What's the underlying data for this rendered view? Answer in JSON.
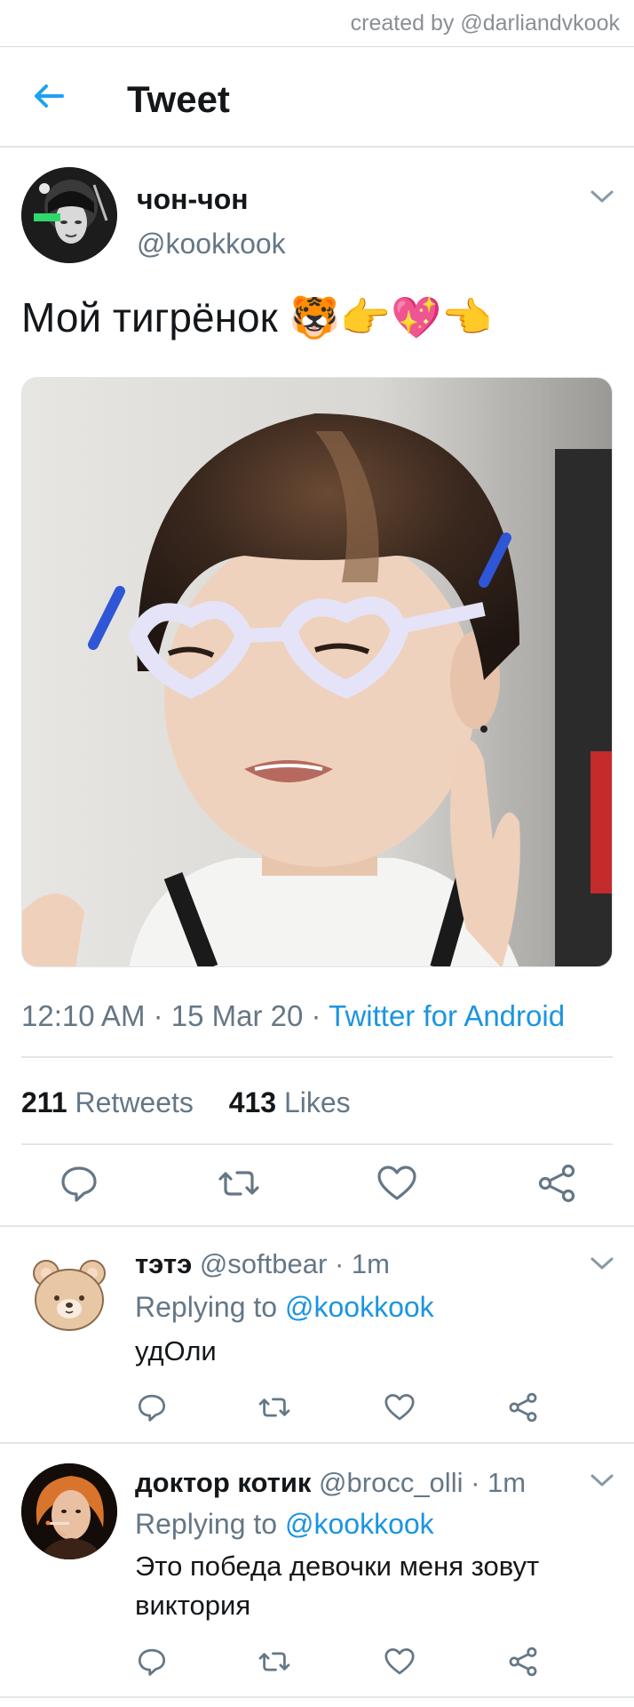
{
  "watermark": "created by @darliandvkook",
  "header": {
    "title": "Tweet",
    "back_icon": "arrow-left-icon",
    "accent": "#1da1f2"
  },
  "tweet": {
    "author_name": "чон-чон",
    "author_handle": "@kookkook",
    "text": "Мой тигрёнок",
    "emojis": "🐯👉💖👈",
    "time": "12:10 AM",
    "date": "15 Mar 20",
    "app": "Twitter for Android",
    "retweets_count": "211",
    "retweets_label": "Retweets",
    "likes_count": "413",
    "likes_label": "Likes",
    "actions": [
      "reply-icon",
      "retweet-icon",
      "like-icon",
      "share-icon"
    ]
  },
  "replies": [
    {
      "name": "тэтэ",
      "handle": "@softbear",
      "time": "· 1m",
      "replying_label": "Replying to",
      "replying_to": "@kookkook",
      "text": "удОли"
    },
    {
      "name": "доктор котик",
      "handle": "@brocc_olli",
      "time": "· 1m",
      "replying_label": "Replying to",
      "replying_to": "@kookkook",
      "text": "Это победа девочки меня зовут виктория"
    }
  ],
  "colors": {
    "link": "#1b95e0",
    "muted": "#657786",
    "divider": "#e1e6ea"
  }
}
